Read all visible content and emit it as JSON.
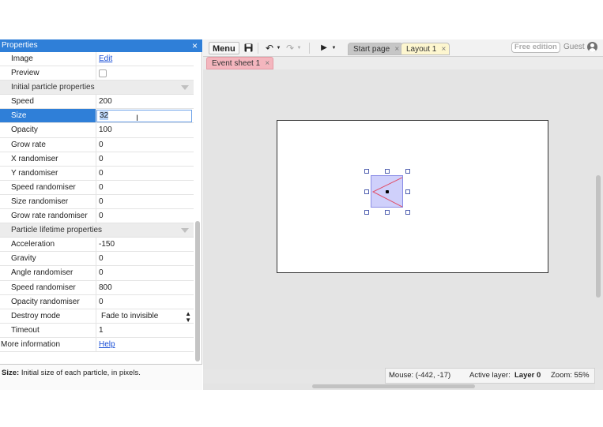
{
  "properties_panel": {
    "title": "Properties",
    "close_glyph": "×",
    "rows": [
      {
        "name": "Image",
        "value": "Edit",
        "kind": "link"
      },
      {
        "name": "Preview",
        "value": "",
        "kind": "checkbox"
      }
    ],
    "section_initial": "Initial particle properties",
    "initial_rows": [
      {
        "name": "Speed",
        "value": "200"
      },
      {
        "name": "Size",
        "value": "32"
      },
      {
        "name": "Opacity",
        "value": "100"
      },
      {
        "name": "Grow rate",
        "value": "0"
      },
      {
        "name": "X randomiser",
        "value": "0"
      },
      {
        "name": "Y randomiser",
        "value": "0"
      },
      {
        "name": "Speed randomiser",
        "value": "0"
      },
      {
        "name": "Size randomiser",
        "value": "0"
      },
      {
        "name": "Grow rate randomiser",
        "value": "0"
      }
    ],
    "section_lifetime": "Particle lifetime properties",
    "lifetime_rows": [
      {
        "name": "Acceleration",
        "value": "-150"
      },
      {
        "name": "Gravity",
        "value": "0"
      },
      {
        "name": "Angle randomiser",
        "value": "0"
      },
      {
        "name": "Speed randomiser",
        "value": "800"
      },
      {
        "name": "Opacity randomiser",
        "value": "0"
      },
      {
        "name": "Destroy mode",
        "value": "Fade to invisible"
      },
      {
        "name": "Timeout",
        "value": "1"
      }
    ],
    "more_info": {
      "name": "More information",
      "value": "Help"
    },
    "description": {
      "label": "Size:",
      "text": "Initial size of each particle, in pixels."
    }
  },
  "toolbar": {
    "menu_label": "Menu",
    "save_glyph": "💾",
    "undo_glyph": "↶",
    "redo_glyph": "↷",
    "play_glyph": "▶",
    "dropdown_glyph": "▼",
    "tabs": [
      {
        "label": "Start page",
        "close": "×"
      },
      {
        "label": "Layout 1",
        "close": "×"
      }
    ],
    "edition_badge": "Free edition",
    "user_label": "Guest"
  },
  "subtabs": [
    {
      "label": "Event sheet 1",
      "close": "×"
    }
  ],
  "status_bar": {
    "mouse": "Mouse: (-442, -17)",
    "active_layer_label": "Active layer:",
    "active_layer_value": "Layer 0",
    "zoom": "Zoom: 55%"
  },
  "colors": {
    "panel_header": "#2f7fd8",
    "layout_tab": "#fdf6cf",
    "event_tab": "#f4b6be",
    "sprite_fill": "#cfd0fb",
    "sprite_lines": "#e0506a"
  }
}
